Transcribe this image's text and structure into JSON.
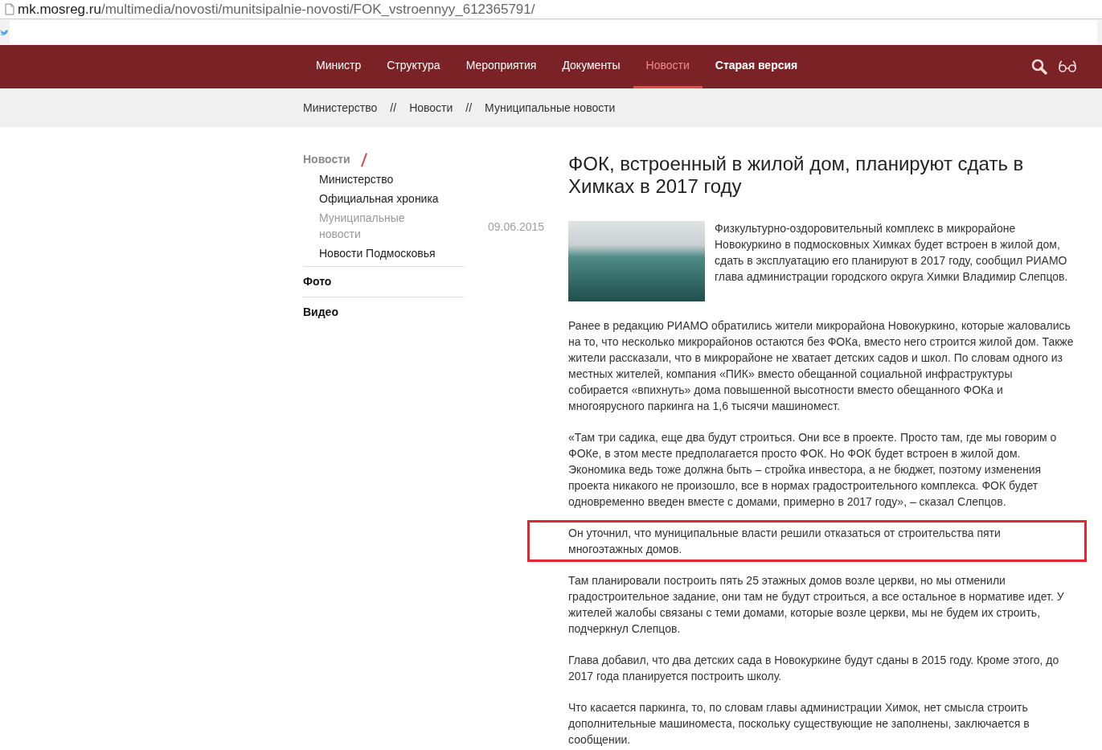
{
  "address_bar": {
    "domain": "mk.mosreg.ru",
    "path": "/multimedia/novosti/munitsipalnie-novosti/FOK_vstroennyy_612365791/"
  },
  "nav": [
    {
      "label": "Министр",
      "selected": false,
      "kind": "link"
    },
    {
      "label": "Структура",
      "selected": false,
      "kind": "link"
    },
    {
      "label": "Мероприятия",
      "selected": false,
      "kind": "link"
    },
    {
      "label": "Документы",
      "selected": false,
      "kind": "link"
    },
    {
      "label": "Новости",
      "selected": true,
      "kind": "link"
    },
    {
      "label": "Старая версия",
      "selected": false,
      "kind": "strong"
    }
  ],
  "breadcrumbs": [
    "Министерство",
    "Новости",
    "Муниципальные новости"
  ],
  "breadcrumb_separator": "//",
  "sidebar": [
    {
      "label": "Новости",
      "selected": true,
      "children": [
        {
          "label": "Министерство",
          "selected": false
        },
        {
          "label": "Официальная хроника",
          "selected": false
        },
        {
          "label": "Муниципальные новости",
          "selected": true
        },
        {
          "label": "Новости Подмосковья",
          "selected": false
        }
      ]
    },
    {
      "label": "Фото",
      "selected": false
    },
    {
      "label": "Видео",
      "selected": false
    }
  ],
  "date": "09.06.2015",
  "article": {
    "title": "ФОК, встроенный в жилой дом, планируют сдать в Химках в 2017 году",
    "lead": "Физкультурно-оздоровительный комплекс в микрорайоне Новокуркино в подмосковных Химках будет встроен в жилой дом, сдать в эксплуатацию его планируют в 2017 году, сообщил РИАМО глава администрации городского округа Химки Владимир Слепцов.",
    "paragraphs": [
      {
        "text": "Ранее в редакцию РИАМО обратились жители микрорайона Новокуркино, которые жаловались на то, что несколько микрорайонов остаются без ФОКа, вместо него строится жилой дом. Также жители рассказали, что в микрорайоне не хватает детских садов и школ. По словам одного из местных жителей, компания «ПИК» вместо обещанной социальной инфраструктуры собирается «впихнуть» дома повышенной высотности вместо обещанного ФОКа и многоярусного паркинга на 1,6 тысячи машиномест.",
        "highlighted": false
      },
      {
        "text": "«Там три садика, еще два будут строиться. Они все в проекте. Просто там, где мы говорим о ФОКе, в этом месте предполагается просто ФОК. Но ФОК будет встроен в жилой дом. Экономика ведь тоже должна быть – стройка инвестора, а не бюджет, поэтому изменения проекта никакого не произошло, все в нормах градостроительного комплекса.  ФОК будет одновременно введен вместе с домами, примерно в 2017 году», – сказал Слепцов.",
        "highlighted": false
      },
      {
        "text": "Он уточнил, что муниципальные власти решили отказаться от строительства пяти многоэтажных домов.",
        "highlighted": true
      },
      {
        "text": "Там планировали построить пять 25 этажных домов возле церкви, но мы отменили градостроительное задание, они там не будут строиться, а все остальное в нормативе идет. У жителей жалобы связаны с теми домами, которые возле церкви, мы не будем их строить, подчеркнул Слепцов.",
        "highlighted": false
      },
      {
        "text": "Глава добавил, что два детских сада в Новокуркине будут сданы в 2015 году. Кроме этого, до 2017 года планируется построить школу.",
        "highlighted": false
      },
      {
        "text": "Что касается паркинга, то, по словам главы администрации Химок, нет смысла строить дополнительные машиноместа, поскольку существующие не заполнены, заключается в сообщении.",
        "highlighted": false
      }
    ]
  }
}
